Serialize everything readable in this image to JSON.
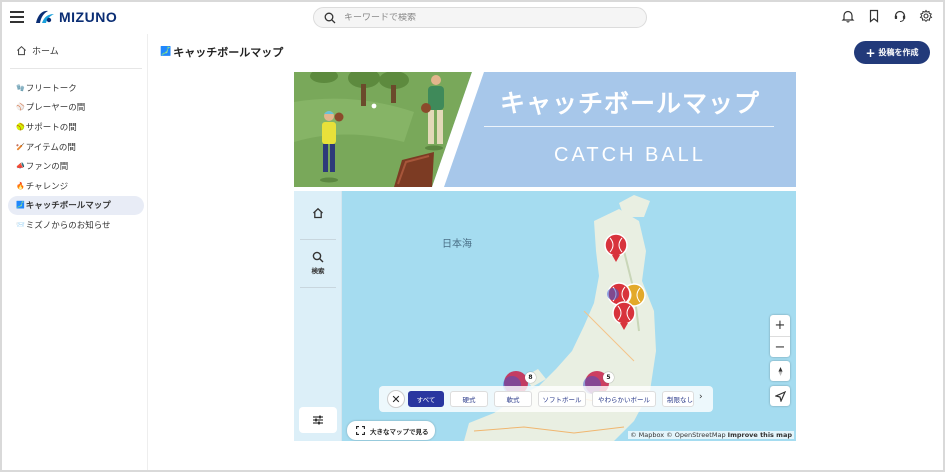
{
  "header": {
    "logo_text": "MIZUNO",
    "search_placeholder": "キーワードで検索"
  },
  "sidebar": {
    "home": "ホーム",
    "items": [
      {
        "emoji": "🧤",
        "label": "フリートーク"
      },
      {
        "emoji": "⚾",
        "label": "プレーヤーの間"
      },
      {
        "emoji": "🥎",
        "label": "サポートの間"
      },
      {
        "emoji": "🏏",
        "label": "アイテムの間"
      },
      {
        "emoji": "📣",
        "label": "ファンの間"
      },
      {
        "emoji": "🔥",
        "label": "チャレンジ"
      },
      {
        "emoji": "🗾",
        "label": "キャッチボールマップ"
      },
      {
        "emoji": "📨",
        "label": "ミズノからのお知らせ"
      }
    ],
    "active_index": 6
  },
  "main": {
    "title_emoji": "🗾",
    "title": "キャッチボールマップ",
    "post_button": "投稿を作成",
    "banner_title": "キャッチボールマップ",
    "banner_subtitle": "CATCH BALL"
  },
  "map": {
    "sea_label": "日本海",
    "search_label": "検索",
    "chips": [
      "すべて",
      "硬式",
      "軟式",
      "ソフトボール",
      "やわらかいボール",
      "制限なし"
    ],
    "active_chip": 0,
    "cluster_counts": [
      "8",
      "5"
    ],
    "big_map_button": "大きなマップで見る",
    "attribution_prefix": "© Mapbox © OpenStreetMap",
    "attribution_link": "Improve this map"
  },
  "colors": {
    "brand_navy": "#223a7a",
    "chip_active": "#2936a0",
    "sea": "#a5dcf0",
    "banner_blue": "#a7c7ea",
    "pin_red": "#d8333c"
  }
}
